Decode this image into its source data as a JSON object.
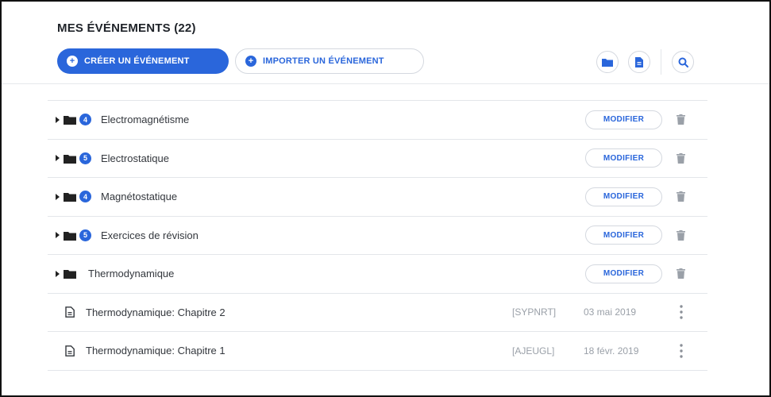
{
  "header": {
    "title": "MES ÉVÉNEMENTS (22)",
    "create_label": "CRÉER UN ÉVÉNEMENT",
    "import_label": "IMPORTER UN ÉVÉNEMENT"
  },
  "folders": [
    {
      "label": "Electromagnétisme",
      "count": "4",
      "action": "MODIFIER"
    },
    {
      "label": "Electrostatique",
      "count": "5",
      "action": "MODIFIER"
    },
    {
      "label": "Magnétostatique",
      "count": "4",
      "action": "MODIFIER"
    },
    {
      "label": "Exercices de révision",
      "count": "5",
      "action": "MODIFIER"
    },
    {
      "label": "Thermodynamique",
      "count": "",
      "action": "MODIFIER"
    }
  ],
  "events": [
    {
      "label": "Thermodynamique: Chapitre 2",
      "code": "[SYPNRT]",
      "date": "03 mai 2019"
    },
    {
      "label": "Thermodynamique: Chapitre 1",
      "code": "[AJEUGL]",
      "date": "18 févr. 2019"
    }
  ],
  "colors": {
    "accent": "#2a66db",
    "divider": "#e3e6ea",
    "muted": "#9aa0a8"
  }
}
